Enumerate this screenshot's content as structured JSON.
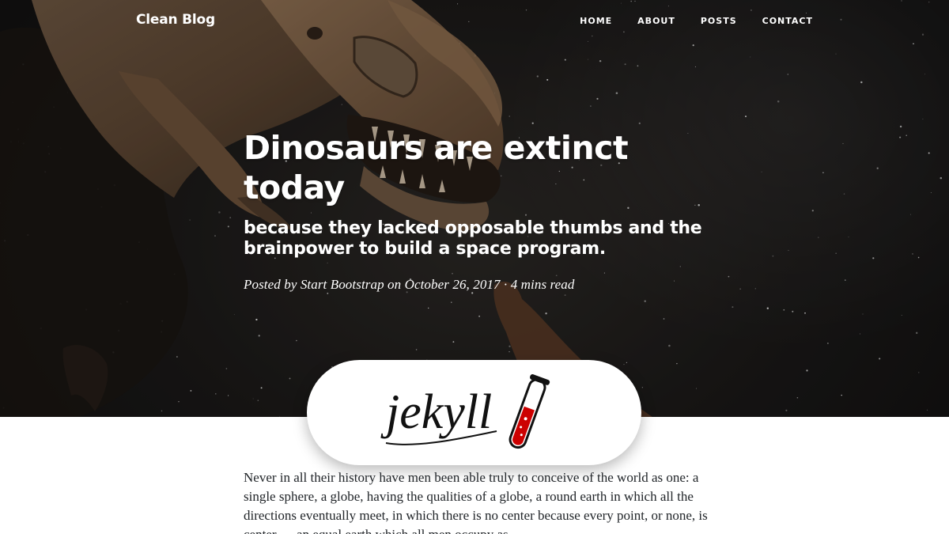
{
  "navbar": {
    "brand": "Clean Blog",
    "links": [
      {
        "label": "HOME"
      },
      {
        "label": "ABOUT"
      },
      {
        "label": "POSTS"
      },
      {
        "label": "CONTACT"
      }
    ]
  },
  "post": {
    "title": "Dinosaurs are extinct today",
    "subtitle": "because they lacked opposable thumbs and the brainpower to build a space program.",
    "meta": "Posted by Start Bootstrap on October 26, 2017 · 4 mins read",
    "logo_text": "jekyll",
    "body": "Never in all their history have men been able truly to conceive of the world as one: a single sphere, a globe, having the qualities of a globe, a round earth in which all the directions eventually meet, in which there is no center because every point, or none, is center — an equal earth which all men occupy as"
  },
  "colors": {
    "hero_bg": "#1b1918",
    "text_light": "#ffffff",
    "body_text": "#212529",
    "logo_red": "#cc0000"
  },
  "icons": {
    "hero_image": "dinosaur-statue-night-sky",
    "logo_icon": "test-tube-icon"
  }
}
